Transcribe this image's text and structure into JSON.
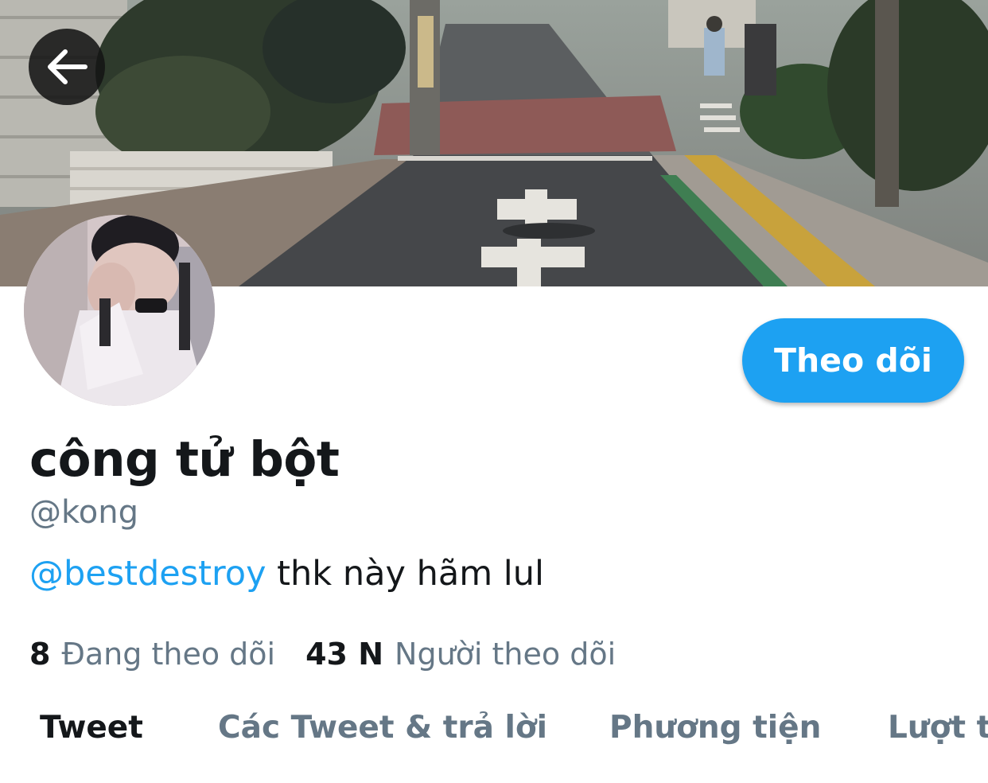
{
  "header": {
    "back_icon": "arrow-left-icon"
  },
  "profile": {
    "display_name": "công tử bột",
    "handle": "@kong",
    "bio": {
      "mention": "@bestdestroy",
      "text": " thk này hãm lul"
    },
    "follow_button_label": "Theo dõi",
    "stats": {
      "following_count": "8",
      "following_label": "Đang theo dõi",
      "followers_count": "43 N",
      "followers_label": "Người theo dõi"
    }
  },
  "tabs": [
    {
      "label": "Tweet",
      "active": true
    },
    {
      "label": "Các Tweet & trả lời",
      "active": false
    },
    {
      "label": "Phương tiện",
      "active": false
    },
    {
      "label": "Lượt thích",
      "active": false
    }
  ],
  "colors": {
    "accent": "#1da1f2",
    "text_primary": "#14171a",
    "text_secondary": "#657786",
    "background": "#ffffff"
  }
}
